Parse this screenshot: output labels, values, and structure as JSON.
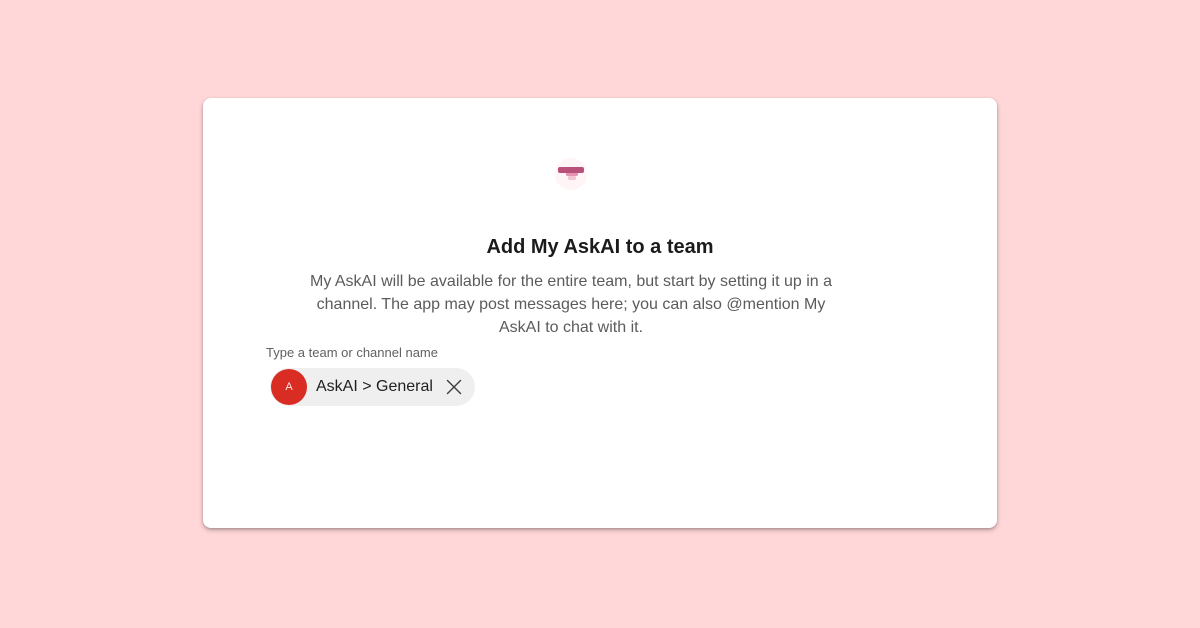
{
  "dialog": {
    "app_icon": "app-logo-icon",
    "title": "Add My AskAI to a team",
    "description": "My AskAI will be available for the entire team, but start by setting it up in a channel. The app may post messages here; you can also @mention My AskAI to chat with it.",
    "field_label": "Type a team or channel name",
    "selected_channel": {
      "avatar_initial": "A",
      "label": "AskAI > General",
      "remove_icon": "close-icon"
    }
  },
  "colors": {
    "page_background": "#ffd7d8",
    "card_background": "#ffffff",
    "avatar": "#d92c23",
    "icon_accent": "#b8507a"
  }
}
